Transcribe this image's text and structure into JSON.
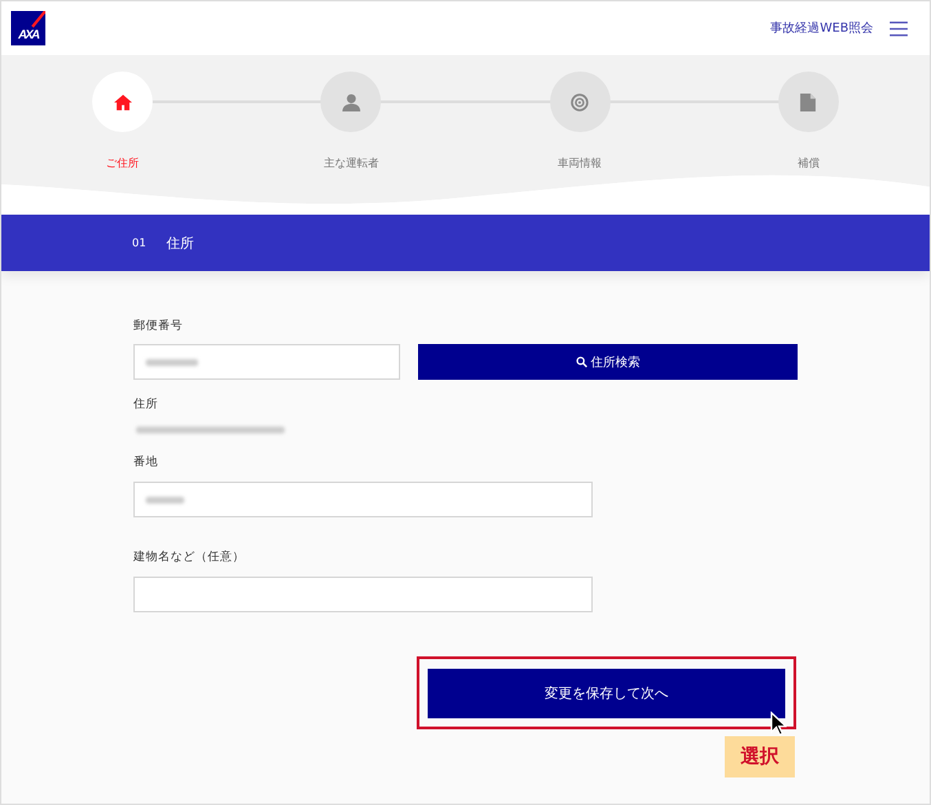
{
  "header": {
    "logo": "AXA",
    "link": "事故経過WEB照会"
  },
  "steps": [
    {
      "label": "ご住所",
      "kind": "home",
      "selected": true
    },
    {
      "label": "主な運転者",
      "kind": "person",
      "selected": false
    },
    {
      "label": "車両情報",
      "kind": "wheel",
      "selected": false
    },
    {
      "label": "補償",
      "kind": "document",
      "selected": false
    }
  ],
  "section": {
    "number": "01",
    "title": "住所"
  },
  "postal": {
    "label": "郵便番号",
    "search_button": "住所検索"
  },
  "address": {
    "label": "住所"
  },
  "street": {
    "label": "番地"
  },
  "building": {
    "label": "建物名など（任意）"
  },
  "save_button": "変更を保存して次へ",
  "callout": "選択"
}
